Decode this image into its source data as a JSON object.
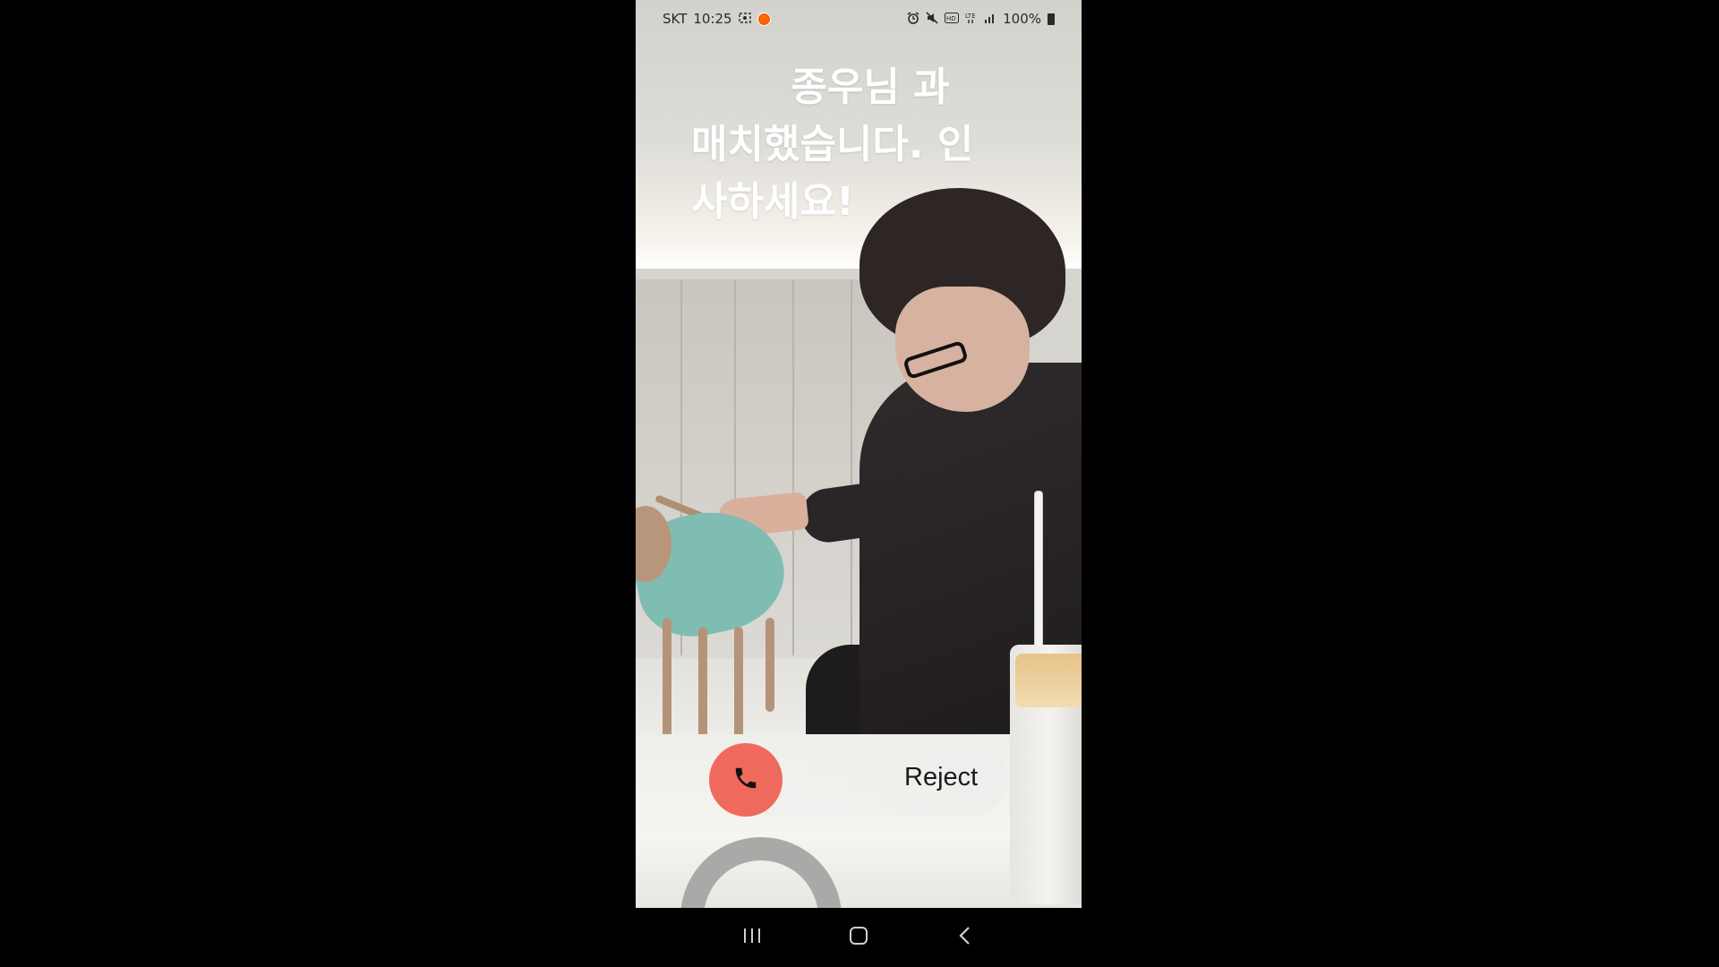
{
  "status_bar": {
    "carrier": "SKT",
    "time": "10:25",
    "battery": "100%",
    "icons": [
      "screenshot-icon",
      "recording-dot-icon",
      "alarm-icon",
      "mute-icon",
      "volte-icon",
      "lte-icon",
      "signal-icon",
      "battery-icon"
    ]
  },
  "headline": {
    "line1": "종우님 과",
    "line2": "매치했습니다. 인",
    "line3": "사하세요!"
  },
  "call_action": {
    "reject_label": "Reject",
    "accent_color": "#EF6A5C"
  },
  "navbar": {
    "items": [
      "recent-apps",
      "home",
      "back"
    ]
  }
}
